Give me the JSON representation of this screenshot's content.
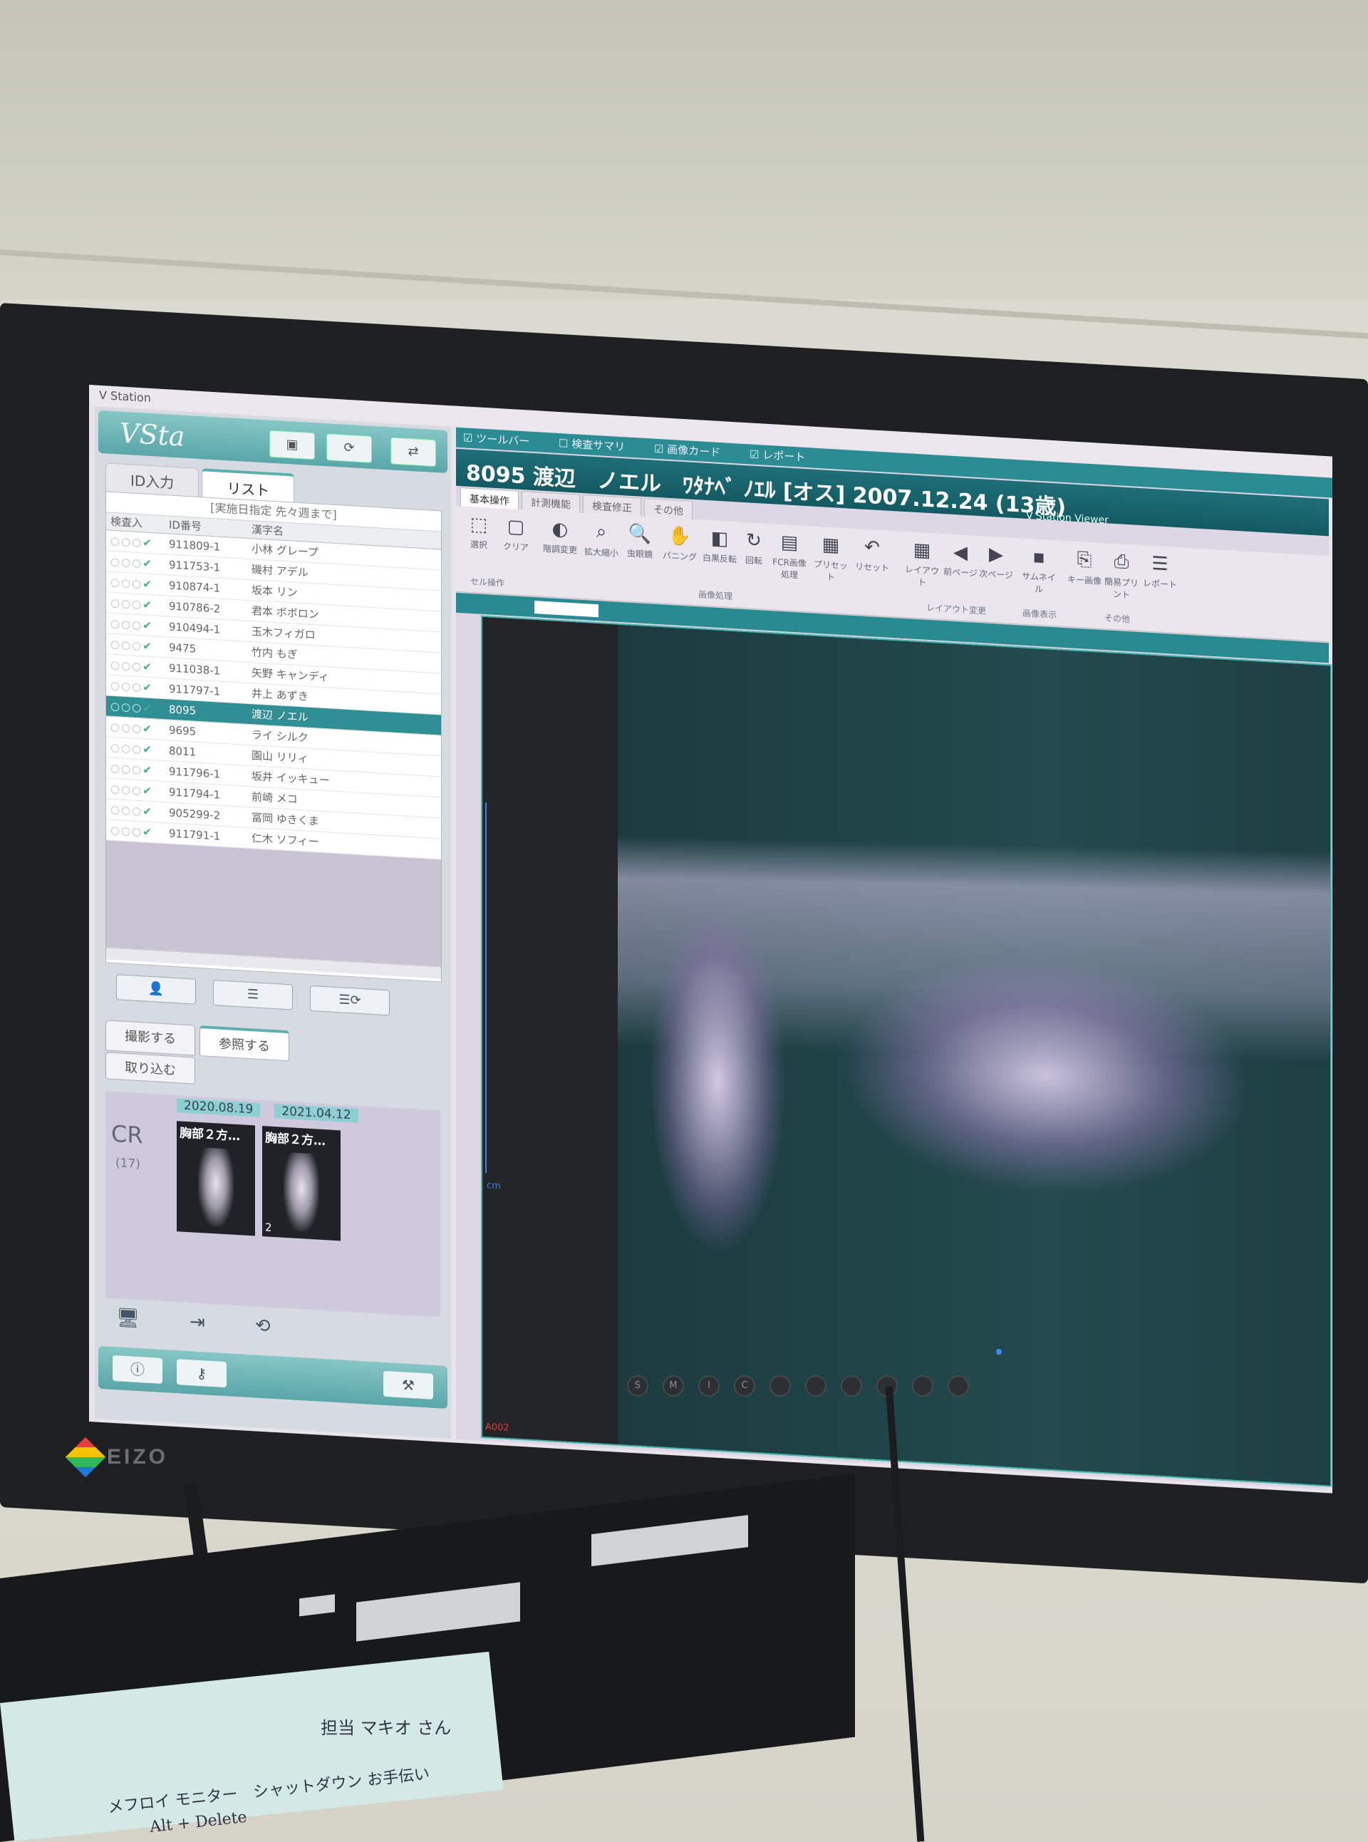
{
  "screen_title": "V Station",
  "logo": "VSta",
  "left_tabs": [
    "ID入力",
    "リスト"
  ],
  "list_filter": "[実施日指定 先々週まで]",
  "list_headers": [
    "検査入",
    "ID番号",
    "漢字名"
  ],
  "patients": [
    {
      "id": "911809-1",
      "name": "小林 グレープ"
    },
    {
      "id": "911753-1",
      "name": "磯村 アデル"
    },
    {
      "id": "910874-1",
      "name": "坂本 リン"
    },
    {
      "id": "910786-2",
      "name": "君本 ボボロン"
    },
    {
      "id": "910494-1",
      "name": "玉木フィガロ"
    },
    {
      "id": "9475",
      "name": "竹内 もぎ"
    },
    {
      "id": "911038-1",
      "name": "矢野 キャンディ"
    },
    {
      "id": "911797-1",
      "name": "井上 あずき"
    },
    {
      "id": "8095",
      "name": "渡辺 ノエル",
      "selected": true
    },
    {
      "id": "9695",
      "name": "ライ シルク"
    },
    {
      "id": "8011",
      "name": "園山 リリィ"
    },
    {
      "id": "911796-1",
      "name": "坂井 イッキュー"
    },
    {
      "id": "911794-1",
      "name": "前崎 メコ"
    },
    {
      "id": "905299-2",
      "name": "冨岡 ゆきくま"
    },
    {
      "id": "911791-1",
      "name": "仁木 ソフィー"
    }
  ],
  "bottom_tabs": [
    "撮影する",
    "参照する"
  ],
  "import_label": "取り込む",
  "study": {
    "dates": [
      "2020.08.19",
      "2021.04.12"
    ],
    "modality": "CR",
    "count": "(17)",
    "thumbs": [
      {
        "label": "胸部２方…",
        "num": ""
      },
      {
        "label": "胸部２方…",
        "num": "2"
      }
    ]
  },
  "viewer": {
    "checks": [
      "ツールバー",
      "検査サマリ",
      "画像カード",
      "レポート"
    ],
    "patient_header": "8095 渡辺　ノエル　ﾜﾀﾅﾍﾞ ﾉｴﾙ [オス] 2007.12.24 (13歳)",
    "title": "V Station Viewer",
    "ribbon_tabs": [
      "基本操作",
      "計測機能",
      "検査修正",
      "その他"
    ],
    "ribbon_buttons": [
      "選択",
      "クリア",
      "階調変更",
      "拡大縮小",
      "虫眼鏡",
      "パニング",
      "白黒反転",
      "回転",
      "FCR画像処理",
      "プリセット",
      "リセット",
      "レイアウト",
      "前ページ",
      "次ページ",
      "サムネイル",
      "キー画像",
      "簡易プリント",
      "レポート"
    ],
    "ribbon_groups": [
      "セル操作",
      "画像処理",
      "レイアウト変更",
      "画像表示",
      "その他"
    ],
    "overlay_bottom_left": "A002",
    "overlay_ruler": "cm"
  },
  "monitor_brand": "EIZO",
  "monitor_buttons": [
    "S",
    "M",
    "I",
    "C",
    "",
    "",
    "",
    "",
    "",
    ""
  ],
  "memo": {
    "top": "担当 マキオ さん",
    "line1": "メフロイ モニター　シャットダウン お手伝い",
    "line2": "Alt + Delete"
  }
}
